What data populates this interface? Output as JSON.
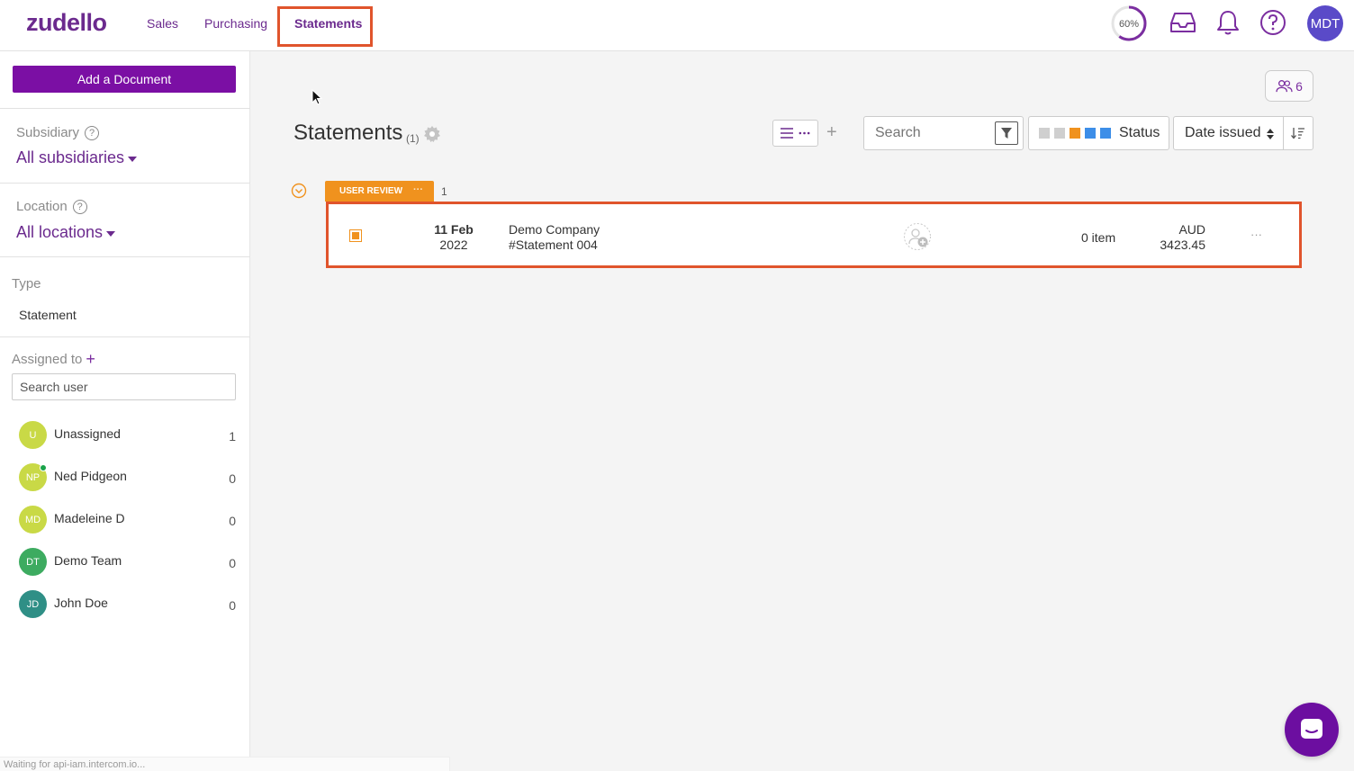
{
  "app": {
    "logo": "zudello"
  },
  "nav": {
    "tabs": [
      {
        "label": "Sales"
      },
      {
        "label": "Purchasing"
      },
      {
        "label": "Statements"
      }
    ]
  },
  "header": {
    "progress": "60%",
    "progress_value": 0.6,
    "user_initials": "MDT"
  },
  "sidebar": {
    "add_document": "Add a Document",
    "subsidiary_label": "Subsidiary",
    "subsidiary_value": "All subsidiaries",
    "location_label": "Location",
    "location_value": "All locations",
    "type_label": "Type",
    "type_value": "Statement",
    "assigned_label": "Assigned to",
    "search_user_value": "Search user",
    "users": [
      {
        "initials": "U",
        "name": "Unassigned",
        "count": "1",
        "color": "#c9d946",
        "online": false
      },
      {
        "initials": "NP",
        "name": "Ned Pidgeon",
        "count": "0",
        "color": "#c9d946",
        "online": true
      },
      {
        "initials": "MD",
        "name": "Madeleine D",
        "count": "0",
        "color": "#c9d946",
        "online": false
      },
      {
        "initials": "DT",
        "name": "Demo Team",
        "count": "0",
        "color": "#3dab60",
        "online": false
      },
      {
        "initials": "JD",
        "name": "John Doe",
        "count": "0",
        "color": "#2f8f86",
        "online": false
      }
    ]
  },
  "main": {
    "title": "Statements",
    "count": "(1)",
    "team_count": "6",
    "search_value": "Search",
    "status_label": "Status",
    "status_colors": [
      "#cfcfcf",
      "#cfcfcf",
      "#f0921e",
      "#3d8ee8",
      "#3d8ee8"
    ],
    "sort_label": "Date issued",
    "group": {
      "label": "USER REVIEW",
      "count": "1",
      "color": "#f0921e"
    },
    "rows": [
      {
        "date_day": "11 Feb",
        "date_year": "2022",
        "company": "Demo Company",
        "reference": "#Statement 004",
        "items": "0 item",
        "currency": "AUD",
        "amount": "3423.45"
      }
    ]
  },
  "status_bar": "Waiting for api-iam.intercom.io...",
  "colors": {
    "brand": "#6b2a8e",
    "accent": "#7b0fa4",
    "highlight": "#e0542c"
  }
}
